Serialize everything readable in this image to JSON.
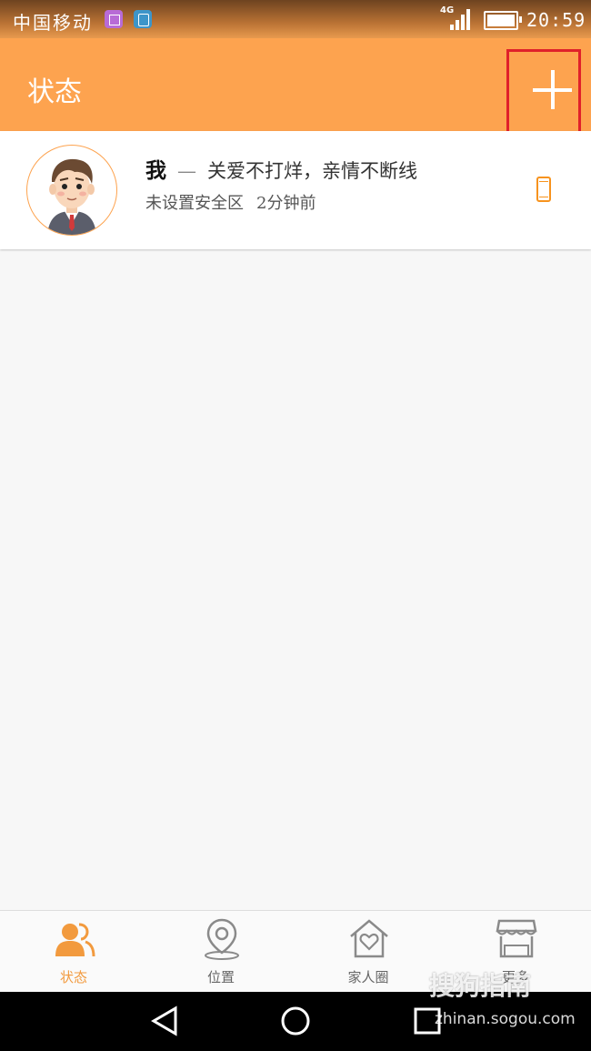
{
  "status_bar": {
    "carrier": "中国移动",
    "network": "4G",
    "time": "20:59"
  },
  "header": {
    "title": "状态",
    "add_icon": "plus-icon"
  },
  "member_card": {
    "name": "我",
    "separator": "—",
    "slogan": "关爱不打烊，亲情不断线",
    "safe_zone": "未设置安全区",
    "last_seen": "2分钟前",
    "device_icon": "phone-icon"
  },
  "tabs": [
    {
      "label": "状态",
      "icon": "people-icon",
      "active": true
    },
    {
      "label": "位置",
      "icon": "location-pin-icon",
      "active": false
    },
    {
      "label": "家人圈",
      "icon": "house-heart-icon",
      "active": false
    },
    {
      "label": "更多",
      "icon": "store-icon",
      "active": false
    }
  ],
  "watermark": {
    "brand": "搜狗指南",
    "url": "zhinan.sogou.com"
  },
  "colors": {
    "accent": "#fda34f",
    "active_tab": "#f29a3e",
    "highlight_box": "#e0202a"
  }
}
